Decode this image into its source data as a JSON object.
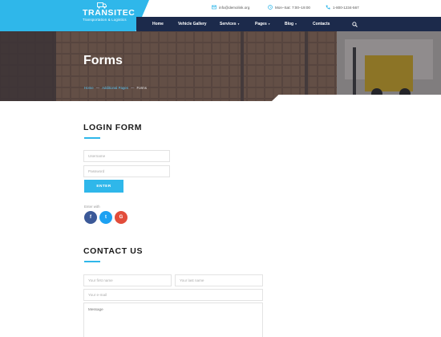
{
  "logo": {
    "title": "TRANSITEC",
    "subtitle": "Transportation & Logistics",
    "icon": "truck-icon",
    "color": "#2fb7ea"
  },
  "header": {
    "email": "info@demolink.org",
    "hours": "Mon–Sat: 7:00–19:00",
    "phone": "1-800-1234-567"
  },
  "nav": {
    "items": [
      {
        "label": "Home"
      },
      {
        "label": "Vehicle Gallery"
      },
      {
        "label": "Services",
        "caret": "▾"
      },
      {
        "label": "Pages",
        "caret": "▾"
      },
      {
        "label": "Blog",
        "caret": "▾"
      },
      {
        "label": "Contacts"
      }
    ],
    "background": "#1c2a4b"
  },
  "hero": {
    "title": "Forms",
    "breadcrumb": {
      "home": "Home",
      "sep": "—",
      "parent": "Additional Pages",
      "current": "Forms"
    }
  },
  "login": {
    "title": "LOGIN FORM",
    "username_placeholder": "Username",
    "password_placeholder": "Password",
    "enter_label": "ENTER",
    "enter_with": "Enter with",
    "social": [
      {
        "label": "f",
        "color": "#3b5998"
      },
      {
        "label": "t",
        "color": "#1da1f2"
      },
      {
        "label": "G",
        "color": "#e24d3b"
      }
    ]
  },
  "contact": {
    "title": "CONTACT US",
    "first_name_placeholder": "Your first name",
    "last_name_placeholder": "Your last name",
    "email_placeholder": "Your e-mail",
    "message_placeholder": "Message"
  }
}
